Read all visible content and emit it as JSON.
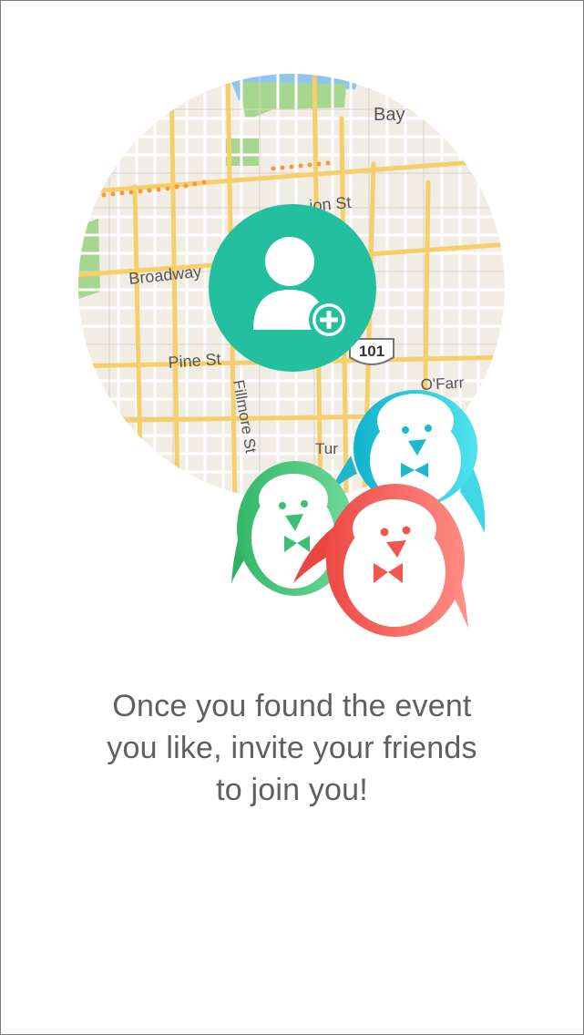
{
  "onboarding": {
    "caption_lines": [
      "Once you found the event",
      "you like, invite your friends",
      "to join you!"
    ]
  },
  "map": {
    "labels": {
      "bay": "Bay",
      "jackson": "ion St",
      "broadway": "Broadway",
      "pine": "Pine St",
      "fillmore": "Fillmore St",
      "highway": "101",
      "ofarrell": "O'Farr",
      "turk": "Tur"
    }
  },
  "icons": {
    "add_friend": "add-friend-icon",
    "penguins": [
      "green-penguin-icon",
      "cyan-penguin-icon",
      "red-penguin-icon"
    ]
  },
  "colors": {
    "accent_teal": "#23bf9e",
    "penguin_green": "#4ccb7e",
    "penguin_cyan": "#22c6da",
    "penguin_red": "#f2564f",
    "caption_text": "#5f5f5f",
    "map_bg": "#f1ede4",
    "map_road": "#f6cf6a",
    "map_park": "#a6d68f",
    "map_water": "#8fc6ee"
  }
}
